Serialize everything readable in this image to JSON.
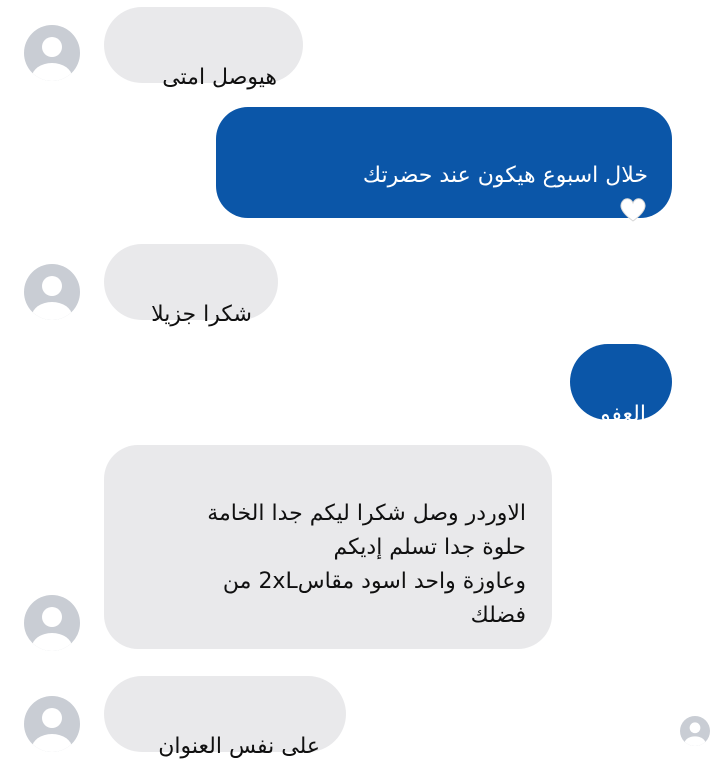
{
  "messages": [
    {
      "direction": "incoming",
      "text": "هيوصل امتى"
    },
    {
      "direction": "outgoing",
      "text": "خلال اسبوع هيكون عند حضرتك",
      "emoji": "white-heart-icon"
    },
    {
      "direction": "incoming",
      "text": "شكرا جزيلا"
    },
    {
      "direction": "outgoing",
      "text": "العفو"
    },
    {
      "direction": "incoming",
      "text": "الاوردر وصل شكرا ليكم جدا الخامة\nحلوة جدا تسلم إديكم\nوعاوزة واحد اسود مقاس2xL من\nفضلك"
    },
    {
      "direction": "incoming",
      "text": "على نفس العنوان"
    }
  ],
  "colors": {
    "outgoing_bubble": "#0b56a8",
    "incoming_bubble": "#e9e9eb",
    "avatar": "#c9cdd4"
  }
}
